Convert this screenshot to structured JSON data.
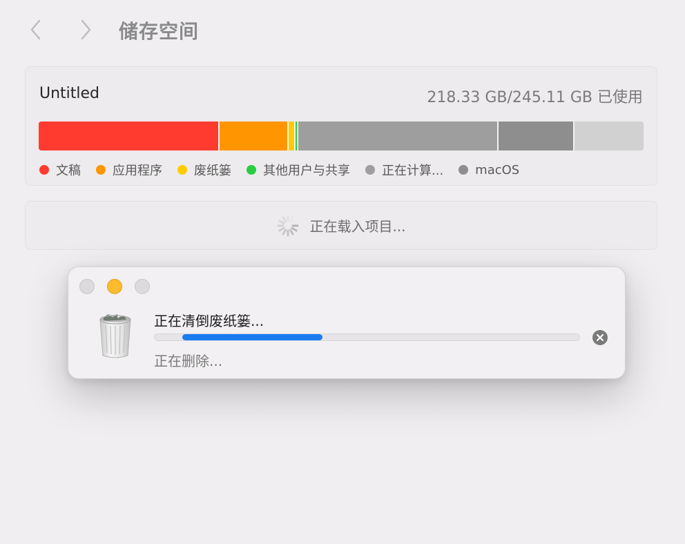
{
  "header": {
    "title": "储存空间",
    "back_icon": "chevron-left-icon",
    "forward_icon": "chevron-right-icon"
  },
  "volume": {
    "name": "Untitled",
    "usage_text": "218.33 GB/245.11 GB 已使用",
    "used_gb": 218.33,
    "total_gb": 245.11,
    "segments": [
      {
        "name": "文稿",
        "color": "#ff3b30",
        "fraction": 0.2995
      },
      {
        "name": "应用程序",
        "color": "#ff9500",
        "fraction": 0.1142
      },
      {
        "name": "废纸篓",
        "color": "#ffcc00",
        "fraction": 0.0114
      },
      {
        "name": "其他用户与共享",
        "color": "#28cd41",
        "fraction": 0.0046
      },
      {
        "name": "正在计算...",
        "color": "#9e9e9e",
        "fraction": 0.3311
      },
      {
        "name": "macOS",
        "color": "#8e8e8e",
        "fraction": 0.1256
      },
      {
        "name": "free",
        "color": "#d1d1d1",
        "fraction": 0.1136
      }
    ],
    "legend": [
      {
        "label": "文稿",
        "color": "#ff3b30"
      },
      {
        "label": "应用程序",
        "color": "#ff9500"
      },
      {
        "label": "废纸篓",
        "color": "#ffcc00"
      },
      {
        "label": "其他用户与共享",
        "color": "#28cd41"
      },
      {
        "label": "正在计算...",
        "color": "#9e9e9e"
      },
      {
        "label": "macOS",
        "color": "#8e8e8e"
      }
    ]
  },
  "loading": {
    "text": "正在载入项目...",
    "icon": "spinner-icon"
  },
  "dialog": {
    "title": "正在清倒废纸篓...",
    "status": "正在删除...",
    "progress_start": 0.065,
    "progress_end": 0.395,
    "progress_color": "#1b7cf2",
    "icon": "trash-icon",
    "cancel_icon": "cancel-icon",
    "traffic_lights": {
      "close": "#dcdadc",
      "minimize": "#fcbc2e",
      "zoom": "#dcdadc"
    }
  }
}
